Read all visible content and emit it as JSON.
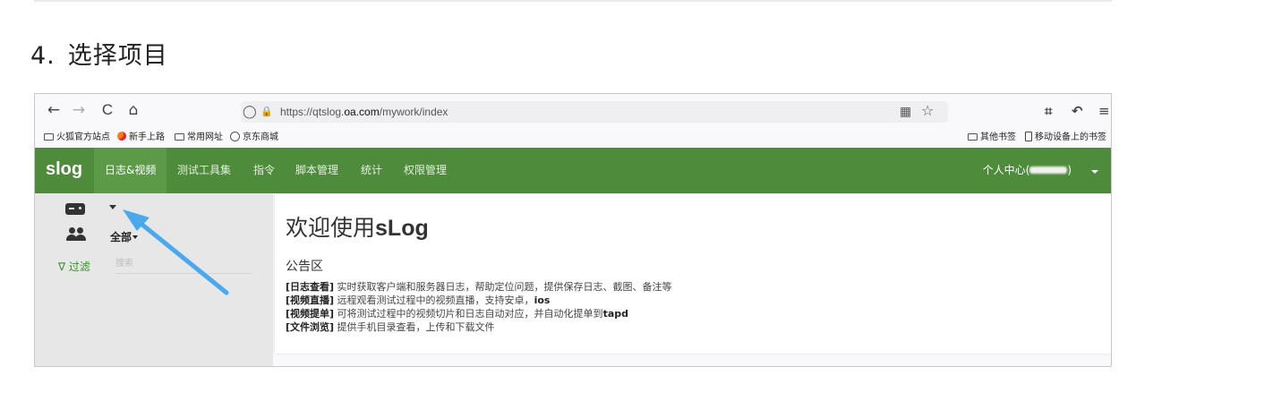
{
  "doc": {
    "step_number": "4.",
    "step_title": "选择项目"
  },
  "browser": {
    "back_icon": "←",
    "forward_icon": "→",
    "reload_icon": "C",
    "home_icon": "⌂",
    "shield_icon": "◯",
    "lock_icon": "🔒",
    "url_prefix": "https://qtslog.",
    "url_domain": "oa.com",
    "url_path": "/mywork/index",
    "qr_icon": "▦",
    "star_icon": "☆",
    "crop_icon": "⌗",
    "undo_icon": "↶",
    "menu_icon": "≡",
    "bookmarks": {
      "left": [
        "火狐官方站点",
        "新手上路",
        "常用网址",
        "京东商城"
      ],
      "right": [
        "其他书签",
        "移动设备上的书签"
      ]
    }
  },
  "app": {
    "brand": "slog",
    "nav": [
      "日志&视频",
      "测试工具集",
      "指令",
      "脚本管理",
      "统计",
      "权限管理"
    ],
    "user_prefix": "个人中心(",
    "user_suffix": ")",
    "sidebar": {
      "all_label": "全部",
      "filter_label": "∇ 过滤",
      "search_placeholder": "搜索"
    },
    "welcome_prefix": "欢迎使用",
    "welcome_brand": "sLog",
    "notice_title": "公告区",
    "notices": [
      {
        "tag": "[日志查看]",
        "text": " 实时获取客户端和服务器日志，帮助定位问题，提供保存日志、截图、备注等",
        "en": ""
      },
      {
        "tag": "[视频直播]",
        "text": " 远程观看测试过程中的视频直播，支持安卓，",
        "en": "ios"
      },
      {
        "tag": "[视频提单]",
        "text": " 可将测试过程中的视频切片和日志自动对应，并自动化提单到",
        "en": "tapd"
      },
      {
        "tag": "[文件浏览]",
        "text": " 提供手机目录查看，上传和下载文件",
        "en": ""
      }
    ]
  },
  "colors": {
    "nav_green": "#4e8b3b",
    "nav_active": "#5c9a48",
    "arrow_blue": "#4aa8ec",
    "filter_green": "#3f8d2e"
  }
}
